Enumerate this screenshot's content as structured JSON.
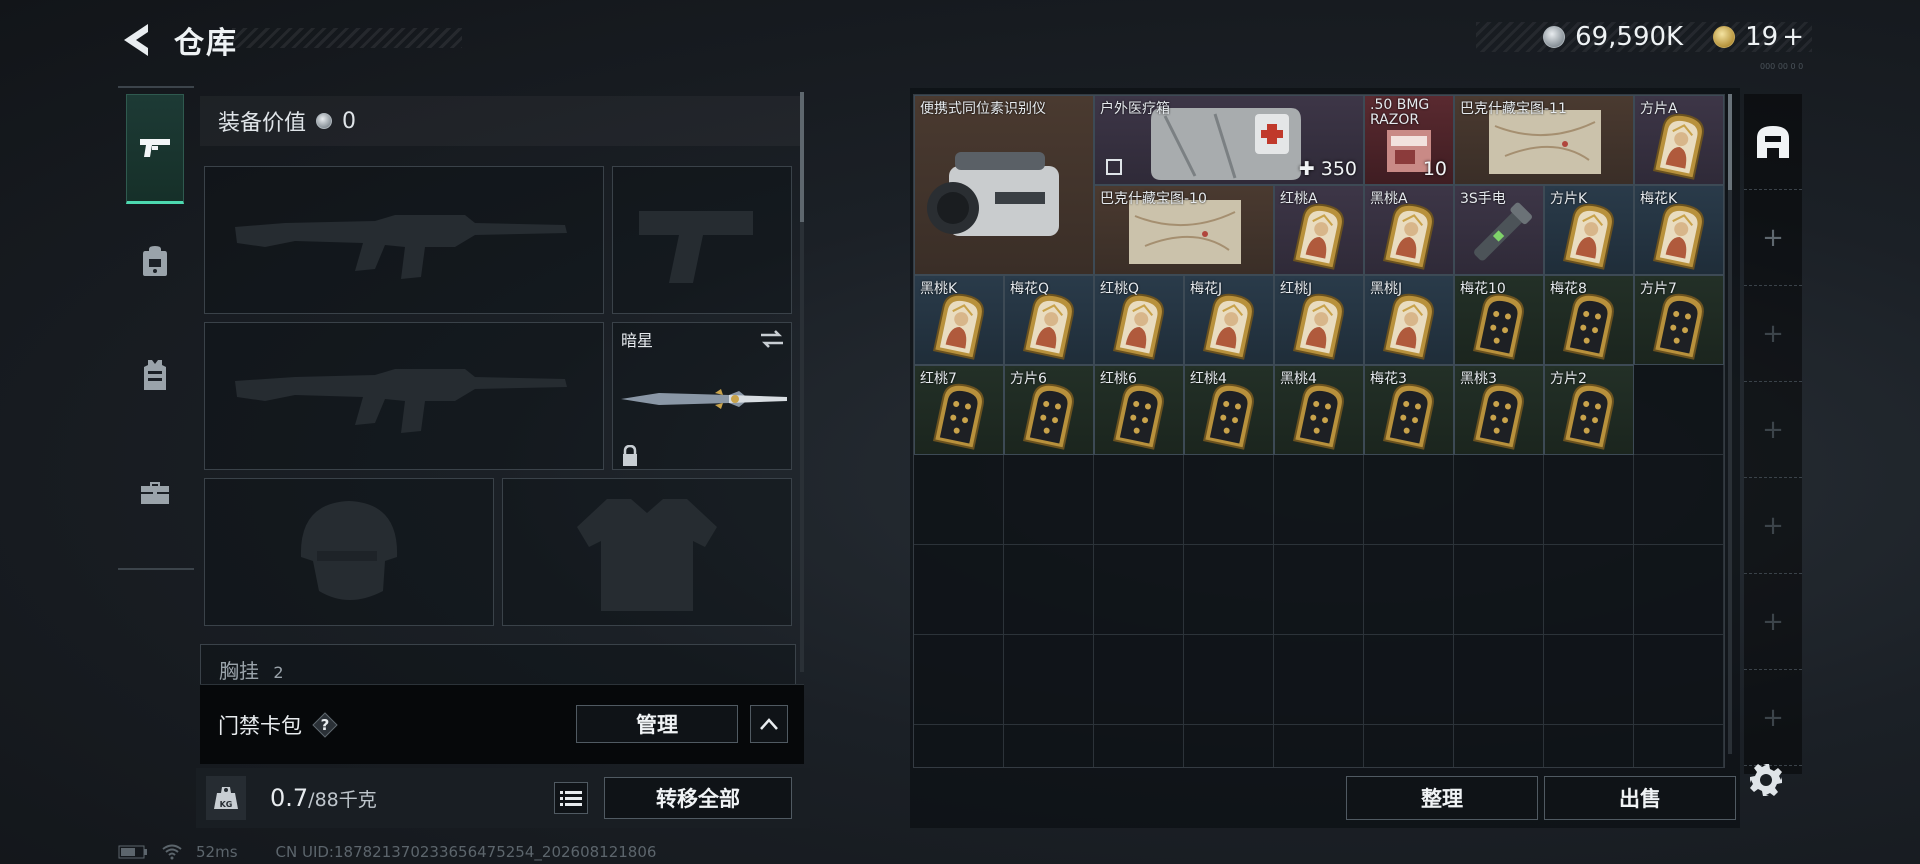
{
  "header": {
    "title": "仓库",
    "silver_amount": "69,590K",
    "gold_amount": "19",
    "gold_plus": "+",
    "corner_tiny": "000 00 0 0"
  },
  "equipment": {
    "value_label": "装备价值",
    "value_amount": "0",
    "melee_name": "暗星",
    "chest_label": "胸挂",
    "chest_count": "2"
  },
  "keycard": {
    "label": "门禁卡包",
    "help": "?",
    "manage_label": "管理"
  },
  "weight": {
    "current": "0.7",
    "capacity": "/88千克",
    "kg_badge": "KG",
    "transfer_label": "转移全部"
  },
  "status": {
    "ping": "52ms",
    "uid": "CN UID:187821370233656475254_202608121806"
  },
  "stash": {
    "sort_label": "整理",
    "sell_label": "出售",
    "items": [
      {
        "name": "便携式同位素识别仪",
        "col": 0,
        "row": 0,
        "w": 2,
        "h": 2,
        "rarity": "brown",
        "art": "scanner"
      },
      {
        "name": "户外医疗箱",
        "col": 2,
        "row": 0,
        "w": 3,
        "h": 1,
        "rarity": "purple",
        "art": "medkit",
        "extra": "350"
      },
      {
        "name": ".50 BMG RAZOR",
        "col": 5,
        "row": 0,
        "w": 1,
        "h": 1,
        "rarity": "red",
        "art": "ammo",
        "extra": "10"
      },
      {
        "name": "巴克什藏宝图-11",
        "col": 6,
        "row": 0,
        "w": 2,
        "h": 1,
        "rarity": "brown",
        "art": "map"
      },
      {
        "name": "方片A",
        "col": 8,
        "row": 0,
        "w": 1,
        "h": 1,
        "rarity": "purple",
        "art": "card-face"
      },
      {
        "name": "巴克什藏宝图-10",
        "col": 2,
        "row": 1,
        "w": 2,
        "h": 1,
        "rarity": "brown",
        "art": "map"
      },
      {
        "name": "红桃A",
        "col": 4,
        "row": 1,
        "w": 1,
        "h": 1,
        "rarity": "purple",
        "art": "card-face"
      },
      {
        "name": "黑桃A",
        "col": 5,
        "row": 1,
        "w": 1,
        "h": 1,
        "rarity": "purple",
        "art": "card-face"
      },
      {
        "name": "3S手电",
        "col": 6,
        "row": 1,
        "w": 1,
        "h": 1,
        "rarity": "purple",
        "art": "flashlight"
      },
      {
        "name": "方片K",
        "col": 7,
        "row": 1,
        "w": 1,
        "h": 1,
        "rarity": "blue",
        "art": "card-face"
      },
      {
        "name": "梅花K",
        "col": 8,
        "row": 1,
        "w": 1,
        "h": 1,
        "rarity": "blue",
        "art": "card-face"
      },
      {
        "name": "黑桃K",
        "col": 0,
        "row": 2,
        "w": 1,
        "h": 1,
        "rarity": "blue",
        "art": "card-face"
      },
      {
        "name": "梅花Q",
        "col": 1,
        "row": 2,
        "w": 1,
        "h": 1,
        "rarity": "blue",
        "art": "card-face"
      },
      {
        "name": "红桃Q",
        "col": 2,
        "row": 2,
        "w": 1,
        "h": 1,
        "rarity": "blue",
        "art": "card-face"
      },
      {
        "name": "梅花J",
        "col": 3,
        "row": 2,
        "w": 1,
        "h": 1,
        "rarity": "blue",
        "art": "card-face"
      },
      {
        "name": "红桃J",
        "col": 4,
        "row": 2,
        "w": 1,
        "h": 1,
        "rarity": "blue",
        "art": "card-face"
      },
      {
        "name": "黑桃J",
        "col": 5,
        "row": 2,
        "w": 1,
        "h": 1,
        "rarity": "blue",
        "art": "card-face"
      },
      {
        "name": "梅花10",
        "col": 6,
        "row": 2,
        "w": 1,
        "h": 1,
        "rarity": "green",
        "art": "card-pip"
      },
      {
        "name": "梅花8",
        "col": 7,
        "row": 2,
        "w": 1,
        "h": 1,
        "rarity": "green",
        "art": "card-pip"
      },
      {
        "name": "方片7",
        "col": 8,
        "row": 2,
        "w": 1,
        "h": 1,
        "rarity": "green",
        "art": "card-pip"
      },
      {
        "name": "红桃7",
        "col": 0,
        "row": 3,
        "w": 1,
        "h": 1,
        "rarity": "green",
        "art": "card-pip"
      },
      {
        "name": "方片6",
        "col": 1,
        "row": 3,
        "w": 1,
        "h": 1,
        "rarity": "green",
        "art": "card-pip"
      },
      {
        "name": "红桃6",
        "col": 2,
        "row": 3,
        "w": 1,
        "h": 1,
        "rarity": "green",
        "art": "card-pip"
      },
      {
        "name": "红桃4",
        "col": 3,
        "row": 3,
        "w": 1,
        "h": 1,
        "rarity": "green",
        "art": "card-pip"
      },
      {
        "name": "黑桃4",
        "col": 4,
        "row": 3,
        "w": 1,
        "h": 1,
        "rarity": "green",
        "art": "card-pip"
      },
      {
        "name": "梅花3",
        "col": 5,
        "row": 3,
        "w": 1,
        "h": 1,
        "rarity": "green",
        "art": "card-pip"
      },
      {
        "name": "黑桃3",
        "col": 6,
        "row": 3,
        "w": 1,
        "h": 1,
        "rarity": "green",
        "art": "card-pip"
      },
      {
        "name": "方片2",
        "col": 7,
        "row": 3,
        "w": 1,
        "h": 1,
        "rarity": "green",
        "art": "card-pip"
      }
    ]
  },
  "grid_spec": {
    "cols": 9,
    "rows": 8
  },
  "icons": {
    "back": "chevron-left-icon",
    "tabs": [
      "pistol-icon",
      "backpack-icon",
      "vest-icon",
      "toolbox-icon"
    ],
    "container_top": "safebox-icon",
    "settings": "gear-icon",
    "swap": "swap-arrows-icon",
    "lock": "lock-icon",
    "list": "list-icon",
    "collapse": "chevron-up-icon"
  },
  "colors": {
    "accent_tab": "#4dd9b0",
    "rarity_blue": "#2a3b4a",
    "rarity_green": "#233027",
    "rarity_purple": "#3d3647",
    "rarity_red": "#5a2a30",
    "rarity_brown": "#4a3a30"
  }
}
